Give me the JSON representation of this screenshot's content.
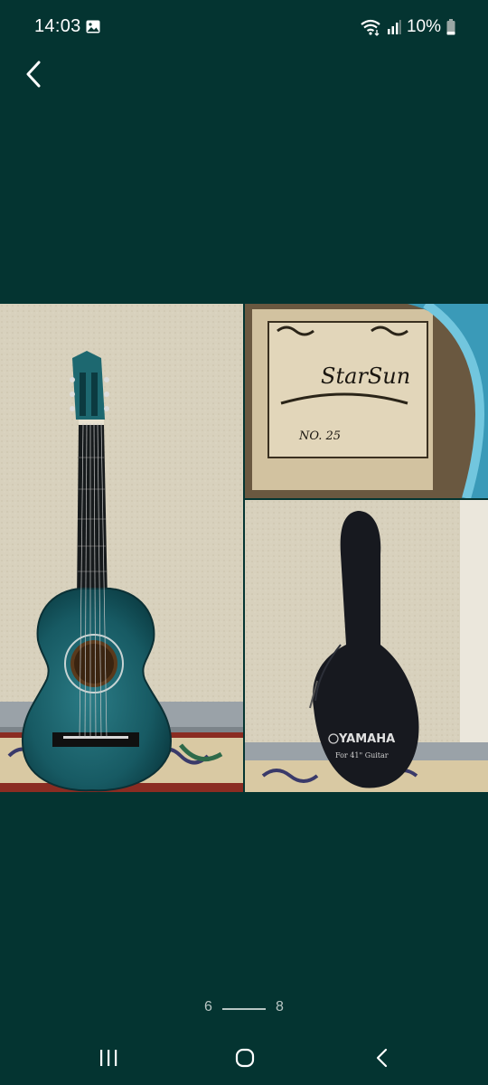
{
  "status_bar": {
    "time": "14:03",
    "battery_percent": "10%",
    "icons": [
      "gallery-icon",
      "wifi-icon",
      "signal-icon",
      "battery-icon"
    ]
  },
  "toolbar": {
    "back_icon": "chevron-left-icon"
  },
  "photos": {
    "label_brand": "StarSun",
    "label_number": "NO. 25",
    "bag_brand": "YAMAHA",
    "bag_subtitle": "For 41\" Guitar"
  },
  "pager": {
    "current": "6",
    "total": "8"
  },
  "nav": {
    "icons": [
      "recent-apps-icon",
      "home-icon",
      "back-nav-icon"
    ]
  },
  "colors": {
    "background": "#043431",
    "guitar_teal": "#1f6a72",
    "wall": "#d6cfbc"
  }
}
